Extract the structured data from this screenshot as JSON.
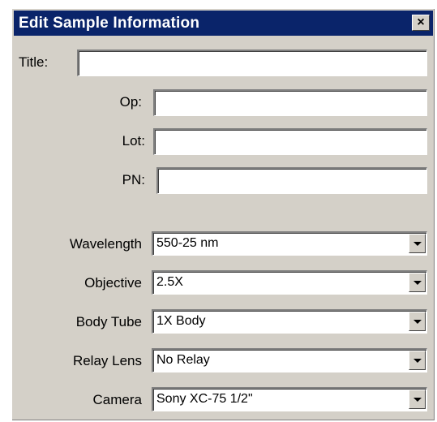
{
  "dialog": {
    "title": "Edit Sample Information",
    "close_glyph": "×"
  },
  "fields": {
    "title": {
      "label": "Title:",
      "value": ""
    },
    "op": {
      "label": "Op:",
      "value": ""
    },
    "lot": {
      "label": "Lot:",
      "value": ""
    },
    "pn": {
      "label": "PN:",
      "value": ""
    }
  },
  "combos": {
    "wavelength": {
      "label": "Wavelength",
      "value": "550-25 nm"
    },
    "objective": {
      "label": "Objective",
      "value": "2.5X"
    },
    "body_tube": {
      "label": "Body Tube",
      "value": "1X Body"
    },
    "relay_lens": {
      "label": "Relay Lens",
      "value": "No Relay"
    },
    "camera": {
      "label": "Camera",
      "value": "Sony XC-75 1/2\""
    }
  },
  "icons": {
    "close": "close-icon",
    "dropdown": "chevron-down-icon"
  }
}
